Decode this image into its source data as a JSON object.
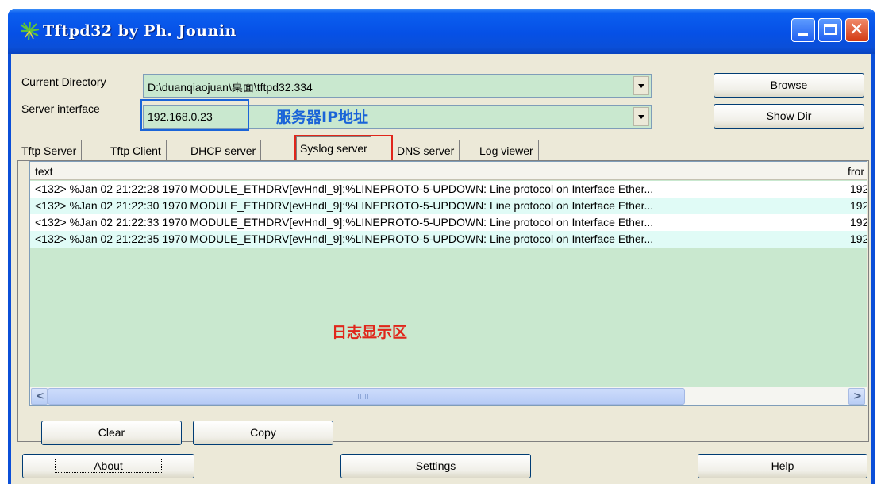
{
  "window": {
    "title": "Tftpd32 by Ph. Jounin"
  },
  "fields": {
    "current_directory": {
      "label": "Current Directory",
      "value": "D:\\duanqiaojuan\\桌面\\tftpd32.334"
    },
    "server_interface": {
      "label": "Server interface",
      "value": "192.168.0.23"
    }
  },
  "buttons": {
    "browse": "Browse",
    "show_dir": "Show Dir",
    "clear": "Clear",
    "copy": "Copy",
    "about": "About",
    "settings": "Settings",
    "help": "Help"
  },
  "tabs": [
    "Tftp Server",
    "Tftp Client",
    "DHCP server",
    "Syslog server",
    "DNS server",
    "Log viewer"
  ],
  "active_tab": "Syslog server",
  "log": {
    "columns": [
      "text",
      "fror"
    ],
    "rows": [
      {
        "text": "<132> %Jan 02 21:22:28 1970 MODULE_ETHDRV[evHndl_9]:%LINEPROTO-5-UPDOWN: Line protocol on Interface Ether...",
        "from": "192"
      },
      {
        "text": "<132> %Jan 02 21:22:30 1970 MODULE_ETHDRV[evHndl_9]:%LINEPROTO-5-UPDOWN: Line protocol on Interface Ether...",
        "from": "192"
      },
      {
        "text": "<132> %Jan 02 21:22:33 1970 MODULE_ETHDRV[evHndl_9]:%LINEPROTO-5-UPDOWN: Line protocol on Interface Ether...",
        "from": "192"
      },
      {
        "text": "<132> %Jan 02 21:22:35 1970 MODULE_ETHDRV[evHndl_9]:%LINEPROTO-5-UPDOWN: Line protocol on Interface Ether...",
        "from": "192"
      }
    ]
  },
  "annotations": {
    "server_ip": "服务器IP地址",
    "log_area": "日志显示区"
  },
  "icons": {
    "app": "tree-icon",
    "minimize": "minimize-icon",
    "maximize": "maximize-icon",
    "close": "close-icon",
    "scroll_left": "arrow-left-icon",
    "scroll_right": "arrow-right-icon"
  },
  "colors": {
    "field_bg": "#c9e8cf",
    "title_bar": "#0a4fd8",
    "annotation_blue": "#1a64d8",
    "annotation_red": "#e0261b",
    "row_alt": "#e0fbf6"
  }
}
